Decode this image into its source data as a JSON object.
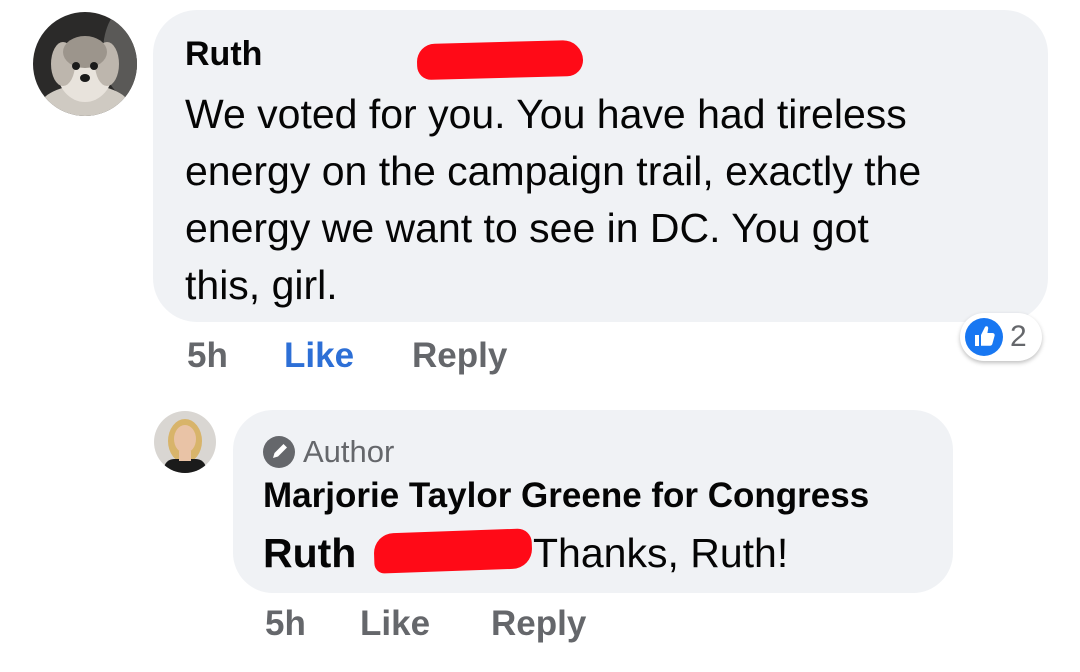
{
  "comment": {
    "author": "Ruth",
    "text": "We voted for you. You have had tireless\nenergy on the campaign trail, exactly the\nenergy we want to see in DC. You got\nthis, girl.",
    "time": "5h",
    "like_label": "Like",
    "reply_label": "Reply",
    "reaction": {
      "icon": "thumbs-up-icon",
      "count": "2",
      "color": "#1877f2"
    },
    "avatar": "dog-avatar"
  },
  "reply": {
    "badge_icon": "pencil-icon",
    "badge_label": "Author",
    "page_name": "Marjorie Taylor Greene for Congress",
    "tagged_name": "Ruth",
    "text": "Thanks, Ruth!",
    "time": "5h",
    "like_label": "Like",
    "reply_label": "Reply",
    "avatar": "woman-avatar"
  },
  "colors": {
    "bubble": "#f0f2f5",
    "link_blue": "#2d6fd6",
    "meta_gray": "#65676b",
    "redaction": "#ff0a17"
  }
}
